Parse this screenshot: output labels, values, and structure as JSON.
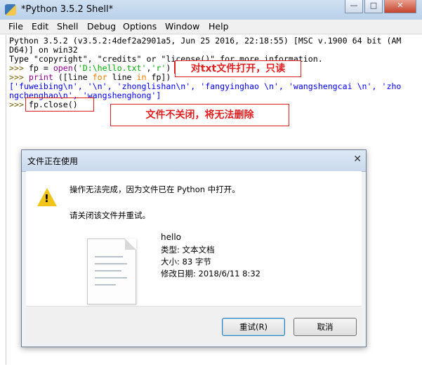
{
  "window": {
    "title": "*Python 3.5.2 Shell*",
    "btn_minimize": "—",
    "btn_maximize": "□",
    "btn_close": "✕"
  },
  "menu": [
    "File",
    "Edit",
    "Shell",
    "Debug",
    "Options",
    "Window",
    "Help"
  ],
  "shell": {
    "banner1": "Python 3.5.2 (v3.5.2:4def2a2901a5, Jun 25 2016, 22:18:55) [MSC v.1900 64 bit (AM",
    "banner2": "D64)] on win32",
    "banner3": "Type \"copyright\", \"credits\" or \"license()\" for more information.",
    "prompt": ">>> ",
    "cmd1_a": "fp = ",
    "cmd1_fn": "open",
    "cmd1_b": "(",
    "cmd1_str1": "'D:\\hello.txt'",
    "cmd1_c": ",",
    "cmd1_str2": "'r'",
    "cmd1_d": ")",
    "cmd2_fn": "print",
    "cmd2_a": " ([line ",
    "cmd2_kw1": "for",
    "cmd2_b": " line ",
    "cmd2_kw2": "in",
    "cmd2_c": " fp])",
    "out1": "['fuweibing\\n', '\\n', 'zhonglishan\\n', 'fangyinghao \\n', 'wangshengcai \\n', 'zho",
    "out2": "ngchenghao\\n', 'wangshenghong']",
    "cmd3": "fp.close()"
  },
  "annotations": {
    "note1": "对txt文件打开，只读",
    "note2": "文件不关闭，将无法删除"
  },
  "dialog": {
    "title": "文件正在使用",
    "close": "✕",
    "message": "操作无法完成，因为文件已在 Python 中打开。",
    "hint": "请关闭该文件并重试。",
    "file_name": "hello",
    "file_type": "类型: 文本文档",
    "file_size": "大小: 83 字节",
    "file_modified": "修改日期: 2018/6/11 8:32",
    "retry_label": "重试(R)",
    "cancel_label": "取消"
  }
}
